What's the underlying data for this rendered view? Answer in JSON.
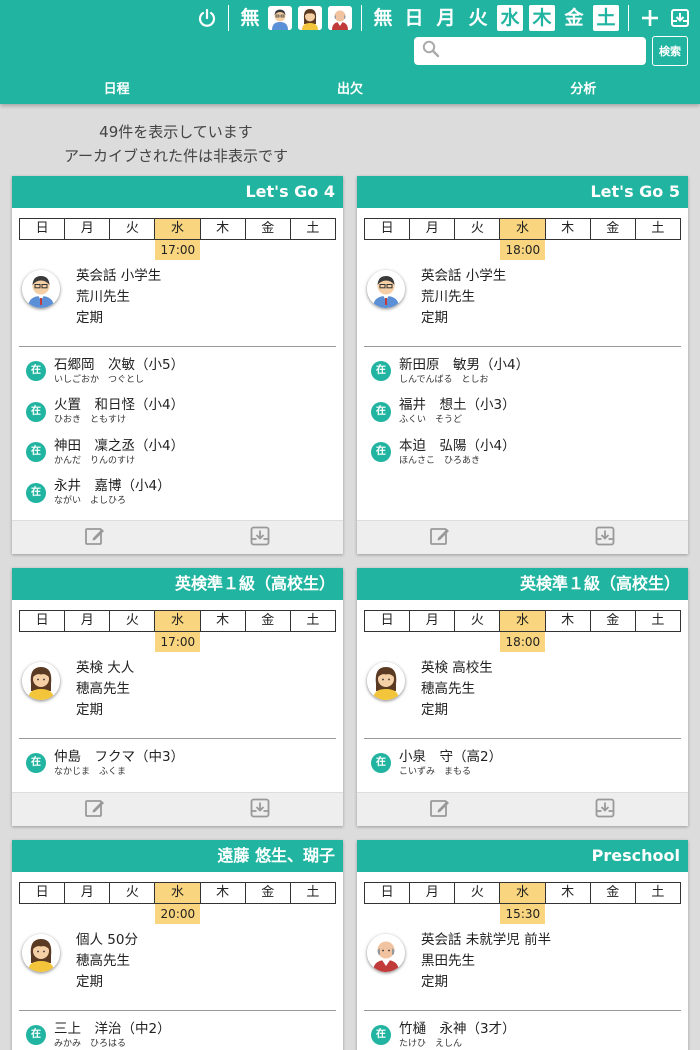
{
  "toolbar": {
    "none_label": "無",
    "none_label2": "無",
    "days": [
      "日",
      "月",
      "火",
      "水",
      "木",
      "金",
      "土"
    ],
    "active_days": [
      3,
      4,
      6
    ]
  },
  "search": {
    "placeholder": "",
    "button_label": "検索"
  },
  "nav": {
    "schedule": "日程",
    "attendance": "出欠",
    "analysis": "分析"
  },
  "info": {
    "count_text": "49件を表示しています",
    "archive_text": "アーカイブされた件は非表示です"
  },
  "day_labels": [
    "日",
    "月",
    "火",
    "水",
    "木",
    "金",
    "土"
  ],
  "cards": [
    {
      "title": "Let's Go 4",
      "time": "17:00",
      "class_name": "英会話 小学生",
      "teacher": "荒川先生",
      "type": "定期",
      "students": [
        {
          "badge": "在",
          "name": "石郷岡　次敏（小5）",
          "kana": "いしごおか　つぐとし"
        },
        {
          "badge": "在",
          "name": "火置　和日怪（小4）",
          "kana": "ひおき　ともすけ"
        },
        {
          "badge": "在",
          "name": "神田　凜之丞（小4）",
          "kana": "かんだ　りんのすけ"
        },
        {
          "badge": "在",
          "name": "永井　嘉博（小4）",
          "kana": "ながい　よしひろ"
        }
      ]
    },
    {
      "title": "Let's Go 5",
      "time": "18:00",
      "class_name": "英会話 小学生",
      "teacher": "荒川先生",
      "type": "定期",
      "students": [
        {
          "badge": "在",
          "name": "新田原　敏男（小4）",
          "kana": "しんでんばる　としお"
        },
        {
          "badge": "在",
          "name": "福井　想土（小3）",
          "kana": "ふくい　そうど"
        },
        {
          "badge": "在",
          "name": "本迫　弘陽（小4）",
          "kana": "ほんさこ　ひろあき"
        }
      ]
    },
    {
      "title": "英検準１級（高校生）",
      "time": "17:00",
      "class_name": "英検 大人",
      "teacher": "穂高先生",
      "type": "定期",
      "students": [
        {
          "badge": "在",
          "name": "仲島　フクマ（中3）",
          "kana": "なかじま　ふくま"
        }
      ]
    },
    {
      "title": "英検準１級（高校生）",
      "time": "18:00",
      "class_name": "英検 高校生",
      "teacher": "穂高先生",
      "type": "定期",
      "students": [
        {
          "badge": "在",
          "name": "小泉　守（高2）",
          "kana": "こいずみ　まもる"
        }
      ]
    },
    {
      "title": "遠藤 悠生、瑚子",
      "time": "20:00",
      "class_name": "個人 50分",
      "teacher": "穂高先生",
      "type": "定期",
      "students": [
        {
          "badge": "在",
          "name": "三上　洋治（中2）",
          "kana": "みかみ　ひろはる"
        }
      ]
    },
    {
      "title": "Preschool",
      "time": "15:30",
      "class_name": "英会話 未就学児 前半",
      "teacher": "黒田先生",
      "type": "定期",
      "students": [
        {
          "badge": "在",
          "name": "竹樋　永神（3才）",
          "kana": "たけひ　えしん"
        }
      ]
    }
  ],
  "colors": {
    "accent": "#21b4a0",
    "highlight": "#f8d57e"
  }
}
